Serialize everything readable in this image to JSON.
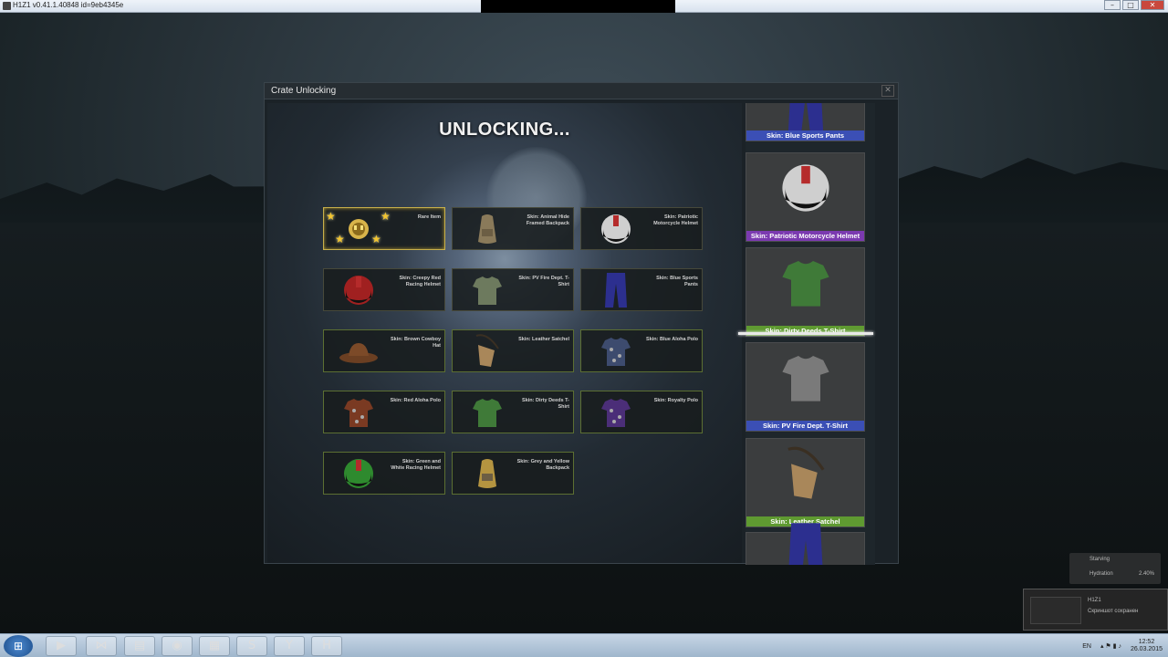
{
  "window": {
    "title": "H1Z1 v0.41.1.40848 id=9eb4345e",
    "min": "–",
    "max": "□",
    "close": "✕"
  },
  "dialog": {
    "title": "Crate Unlocking",
    "close": "✕",
    "heading": "UNLOCKING..."
  },
  "items": [
    {
      "label": "Rare Item",
      "icon": "rare-item-icon",
      "style": "gold"
    },
    {
      "label": "Skin: Animal Hide Framed Backpack",
      "icon": "backpack-icon",
      "style": "plain"
    },
    {
      "label": "Skin: Patriotic Motorcycle Helmet",
      "icon": "helmet-icon",
      "style": "plain"
    },
    {
      "label": "Skin: Creepy Red Racing Helmet",
      "icon": "helmet-icon",
      "style": "plain"
    },
    {
      "label": "Skin: PV Fire Dept. T-Shirt",
      "icon": "tshirt-icon",
      "style": "plain"
    },
    {
      "label": "Skin: Blue Sports Pants",
      "icon": "pants-icon",
      "style": "plain"
    },
    {
      "label": "Skin: Brown Cowboy Hat",
      "icon": "hat-icon",
      "style": "green"
    },
    {
      "label": "Skin: Leather Satchel",
      "icon": "satchel-icon",
      "style": "green"
    },
    {
      "label": "Skin: Blue Aloha Polo",
      "icon": "shirt-icon",
      "style": "green"
    },
    {
      "label": "Skin: Red Aloha Polo",
      "icon": "shirt-icon",
      "style": "green"
    },
    {
      "label": "Skin: Dirty Deeds T-Shirt",
      "icon": "tshirt-icon",
      "style": "green"
    },
    {
      "label": "Skin: Royalty Polo",
      "icon": "shirt-icon",
      "style": "green"
    },
    {
      "label": "Skin: Green and White Racing Helmet",
      "icon": "helmet-icon",
      "style": "green"
    },
    {
      "label": "Skin: Grey and Yellow Backpack",
      "icon": "backpack-icon",
      "style": "green"
    }
  ],
  "reel": [
    {
      "caption": "Skin: Blue Sports Pants",
      "tier": "blue"
    },
    {
      "caption": "Skin: Patriotic Motorcycle Helmet",
      "tier": "purple"
    },
    {
      "caption": "Skin: Dirty Deeds T-Shirt",
      "tier": "green"
    },
    {
      "caption": "Skin: PV Fire Dept. T-Shirt",
      "tier": "blue"
    },
    {
      "caption": "Skin: Leather Satchel",
      "tier": "green"
    },
    {
      "caption": "",
      "tier": "blue"
    }
  ],
  "notification": {
    "line1": "Starving",
    "line2": "Hydration",
    "line3": "2.40%"
  },
  "steam_toast": {
    "title": "H1Z1",
    "text": "Скриншот сохранен"
  },
  "taskbar": {
    "lang": "EN",
    "time": "12:52",
    "date": "26.03.2015"
  }
}
